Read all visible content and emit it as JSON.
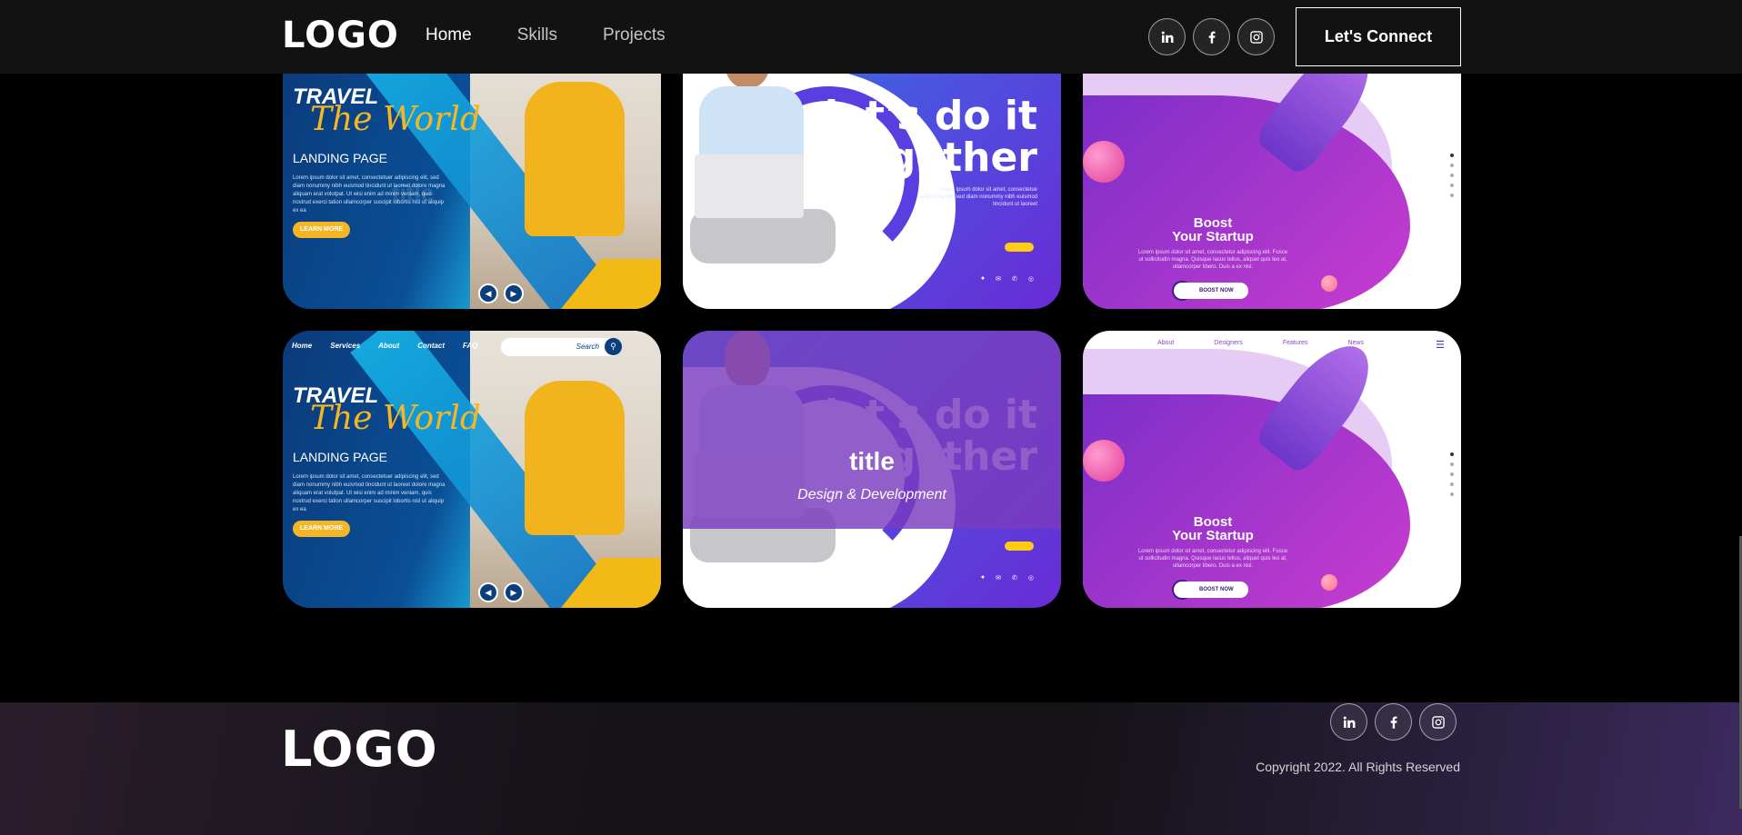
{
  "nav": {
    "logo": "LOGO",
    "links": [
      "Home",
      "Skills",
      "Projects"
    ],
    "active": "Home",
    "social": [
      "linkedin-icon",
      "facebook-icon",
      "instagram-icon"
    ],
    "cta": "Let's Connect"
  },
  "projects": {
    "travel": {
      "title_line1": "TRAVEL",
      "title_line2": "The World",
      "subtitle": "LANDING PAGE",
      "body": "Lorem ipsum dolor sit amet, consectetuer adipiscing elit, sed diam nonummy nibh euismod tincidunt ut laoreet dolore magna aliquam erat volutpat. Ut wisi enim ad minim veniam, quis nostrud exerci tation ullamcorper suscipit lobortis nisl ut aliquip ex ea",
      "button": "LEARN MORE",
      "menu": [
        "Home",
        "Services",
        "About",
        "Contact",
        "FAQ"
      ],
      "search_placeholder": "Search"
    },
    "together": {
      "headline_line1": "let's do it",
      "headline_line2": "together",
      "body": "Lorem ipsum dolor sit amet, consectetue adipiscing elit, sed diam nonummy nibh euismod tincidunt ut laoreet"
    },
    "startup": {
      "headline_line1": "Boost",
      "headline_line2": "Your Startup",
      "body": "Lorem ipsum dolor sit amet, consectetur adipiscing elit. Fusce ut sollicitudin magna. Quisque lacus tellus, aliquet quis leo at, ullamcorper libero. Duis a ex nisl.",
      "button": "BOOST NOW",
      "menu": [
        "About",
        "Designers",
        "Features",
        "News"
      ]
    },
    "overlay": {
      "title": "title",
      "subtitle": "Design & Development"
    }
  },
  "footer": {
    "logo": "LOGO",
    "social": [
      "linkedin-icon",
      "facebook-icon",
      "instagram-icon"
    ],
    "copyright": "Copyright 2022. All Rights Reserved"
  }
}
